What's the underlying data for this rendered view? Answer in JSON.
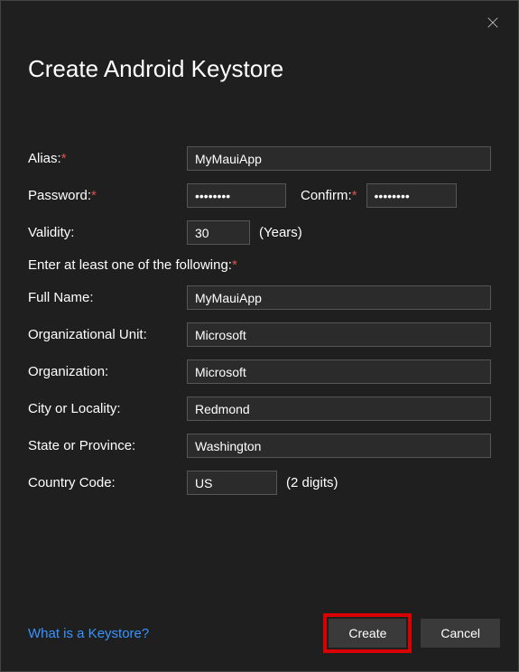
{
  "dialog": {
    "title": "Create Android Keystore"
  },
  "fields": {
    "alias": {
      "label": "Alias:",
      "value": "MyMauiApp"
    },
    "password": {
      "label": "Password:",
      "value": "••••••••"
    },
    "confirm": {
      "label": "Confirm:",
      "value": "••••••••"
    },
    "validity": {
      "label": "Validity:",
      "value": "30",
      "unit": "(Years)"
    },
    "section": "Enter at least one of the following:",
    "fullname": {
      "label": "Full Name:",
      "value": "MyMauiApp"
    },
    "orgunit": {
      "label": "Organizational Unit:",
      "value": "Microsoft"
    },
    "org": {
      "label": "Organization:",
      "value": "Microsoft"
    },
    "city": {
      "label": "City or Locality:",
      "value": "Redmond"
    },
    "state": {
      "label": "State or Province:",
      "value": "Washington"
    },
    "country": {
      "label": "Country Code:",
      "value": "US",
      "unit": "(2 digits)"
    }
  },
  "footer": {
    "link": "What is a Keystore?",
    "create": "Create",
    "cancel": "Cancel"
  }
}
